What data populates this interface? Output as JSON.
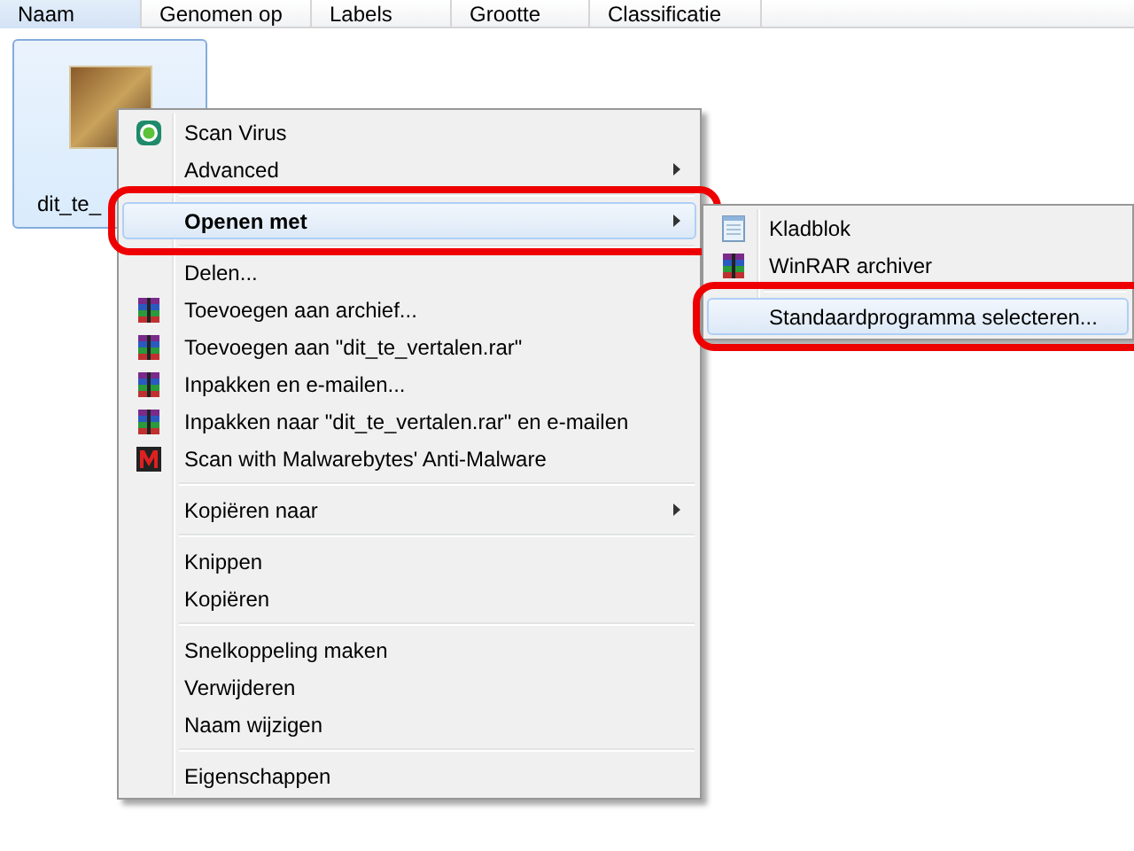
{
  "columns": [
    {
      "label": "Naam",
      "selected": true
    },
    {
      "label": "Genomen op",
      "selected": false
    },
    {
      "label": "Labels",
      "selected": false
    },
    {
      "label": "Grootte",
      "selected": false
    },
    {
      "label": "Classificatie",
      "selected": false
    }
  ],
  "file": {
    "label": "dit_te_",
    "selected": true
  },
  "context_menu": {
    "items": [
      {
        "kind": "antivirus",
        "label": "Scan Virus",
        "submenu": false,
        "selected": false,
        "bold": false,
        "circled": false
      },
      {
        "kind": "item",
        "label": "Advanced",
        "submenu": true,
        "selected": false,
        "bold": false,
        "circled": false
      },
      {
        "kind": "separator"
      },
      {
        "kind": "item",
        "label": "Openen met",
        "submenu": true,
        "selected": true,
        "bold": true,
        "circled": true
      },
      {
        "kind": "separator"
      },
      {
        "kind": "item",
        "label": "Delen...",
        "submenu": false,
        "selected": false,
        "bold": false,
        "circled": false
      },
      {
        "kind": "archive",
        "label": "Toevoegen aan archief...",
        "submenu": false,
        "selected": false,
        "bold": false,
        "circled": false
      },
      {
        "kind": "archive",
        "label": "Toevoegen aan \"dit_te_vertalen.rar\"",
        "submenu": false,
        "selected": false,
        "bold": false,
        "circled": false
      },
      {
        "kind": "archive",
        "label": "Inpakken en e-mailen...",
        "submenu": false,
        "selected": false,
        "bold": false,
        "circled": false
      },
      {
        "kind": "archive",
        "label": "Inpakken naar \"dit_te_vertalen.rar\" en e-mailen",
        "submenu": false,
        "selected": false,
        "bold": false,
        "circled": false
      },
      {
        "kind": "malware",
        "label": "Scan with Malwarebytes' Anti-Malware",
        "submenu": false,
        "selected": false,
        "bold": false,
        "circled": false
      },
      {
        "kind": "separator"
      },
      {
        "kind": "item",
        "label": "Kopiëren naar",
        "submenu": true,
        "selected": false,
        "bold": false,
        "circled": false
      },
      {
        "kind": "separator"
      },
      {
        "kind": "item",
        "label": "Knippen",
        "submenu": false,
        "selected": false,
        "bold": false,
        "circled": false
      },
      {
        "kind": "item",
        "label": "Kopiëren",
        "submenu": false,
        "selected": false,
        "bold": false,
        "circled": false
      },
      {
        "kind": "separator"
      },
      {
        "kind": "item",
        "label": "Snelkoppeling maken",
        "submenu": false,
        "selected": false,
        "bold": false,
        "circled": false
      },
      {
        "kind": "item",
        "label": "Verwijderen",
        "submenu": false,
        "selected": false,
        "bold": false,
        "circled": false
      },
      {
        "kind": "item",
        "label": "Naam wijzigen",
        "submenu": false,
        "selected": false,
        "bold": false,
        "circled": false
      },
      {
        "kind": "separator"
      },
      {
        "kind": "item",
        "label": "Eigenschappen",
        "submenu": false,
        "selected": false,
        "bold": false,
        "circled": false
      }
    ]
  },
  "submenu": {
    "items": [
      {
        "kind": "notepad",
        "label": "Kladblok",
        "submenu": false,
        "selected": false,
        "bold": false,
        "circled": false
      },
      {
        "kind": "archive",
        "label": "WinRAR archiver",
        "submenu": false,
        "selected": false,
        "bold": false,
        "circled": false
      },
      {
        "kind": "separator"
      },
      {
        "kind": "item",
        "label": "Standaardprogramma selecteren...",
        "submenu": false,
        "selected": true,
        "bold": false,
        "circled": true
      }
    ]
  }
}
